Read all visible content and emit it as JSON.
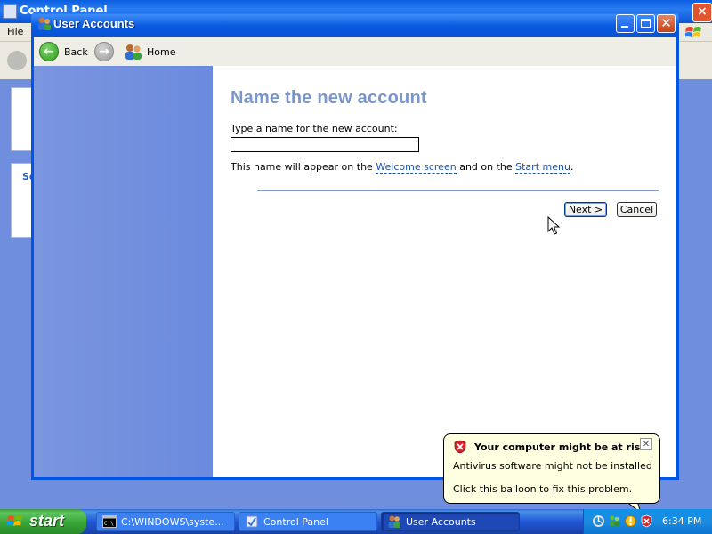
{
  "background_window": {
    "title": "Control Panel",
    "menu_file": "File",
    "panel_heading_fragment": "Se"
  },
  "window": {
    "title": "User Accounts"
  },
  "toolbar": {
    "back_label": "Back",
    "home_label": "Home"
  },
  "content": {
    "heading": "Name the new account",
    "prompt_label": "Type a name for the new account:",
    "name_value": "",
    "info_before": "This name will appear on the ",
    "info_link1": "Welcome screen",
    "info_middle": " and on the ",
    "info_link2": "Start menu",
    "info_after": ".",
    "next_label": "Next >",
    "cancel_label": "Cancel"
  },
  "balloon": {
    "title": "Your computer might be at risk",
    "line1": "Antivirus software might not be installed",
    "line2": "Click this balloon to fix this problem."
  },
  "taskbar": {
    "start_label": "start",
    "tasks": [
      {
        "label": "C:\\WINDOWS\\syste...",
        "icon": "cmd-icon"
      },
      {
        "label": "Control Panel",
        "icon": "control-panel-icon"
      },
      {
        "label": "User Accounts",
        "icon": "user-accounts-icon",
        "active": true
      }
    ],
    "clock": "6:34 PM"
  },
  "colors": {
    "heading": "#7a96c8",
    "link": "#1a4fb3",
    "left_pane": "#7a96df",
    "balloon_bg": "#ffffe1",
    "taskbar_blue": "#245edb",
    "start_green": "#3c9a3c"
  }
}
